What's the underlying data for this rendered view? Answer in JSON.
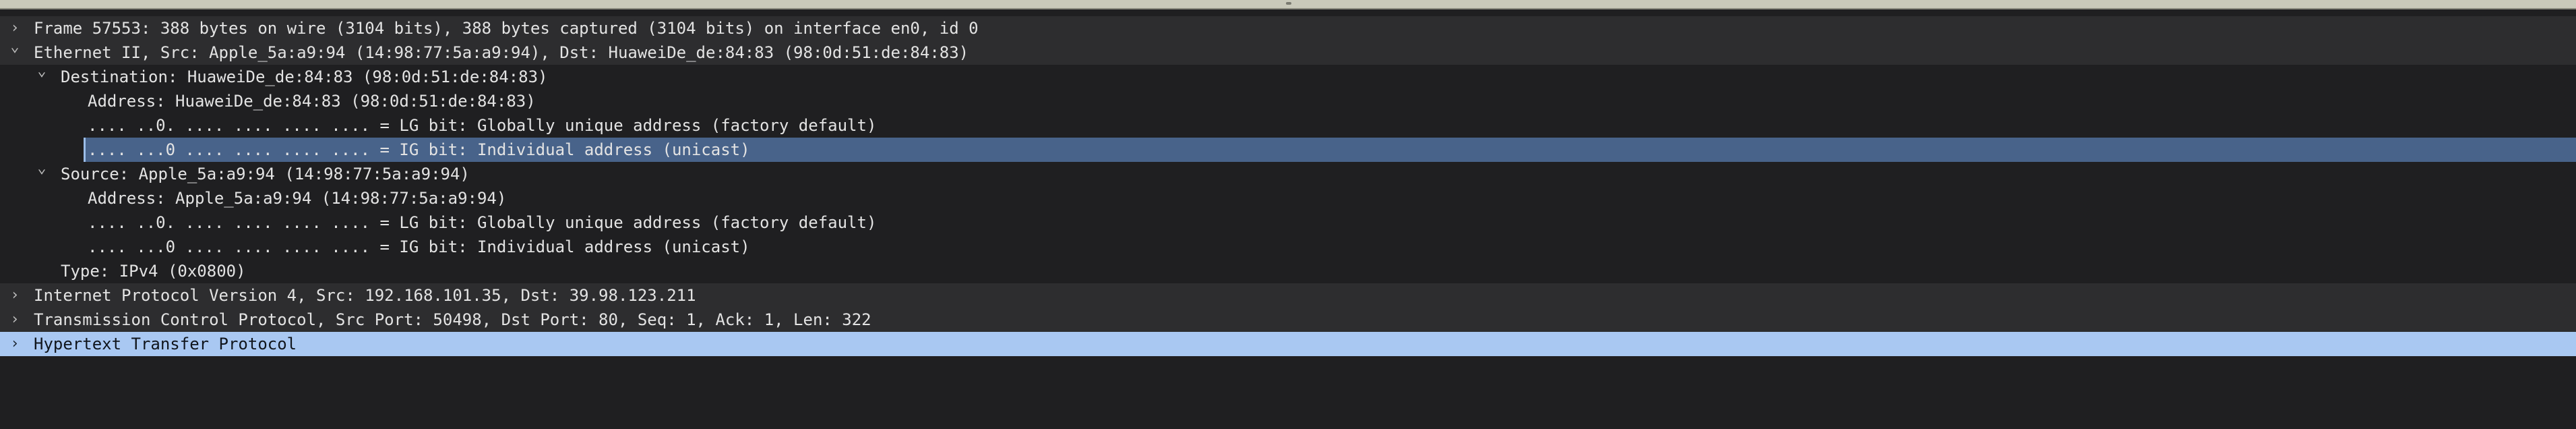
{
  "packet_details": {
    "rows": [
      {
        "text": "Frame 57553: 388 bytes on wire (3104 bits), 388 bytes captured (3104 bits) on interface en0, id 0"
      },
      {
        "text": "Ethernet II, Src: Apple_5a:a9:94 (14:98:77:5a:a9:94), Dst: HuaweiDe_de:84:83 (98:0d:51:de:84:83)"
      },
      {
        "text": "Destination: HuaweiDe_de:84:83 (98:0d:51:de:84:83)"
      },
      {
        "text": "Address: HuaweiDe_de:84:83 (98:0d:51:de:84:83)"
      },
      {
        "text": ".... ..0. .... .... .... .... = LG bit: Globally unique address (factory default)"
      },
      {
        "text": ".... ...0 .... .... .... .... = IG bit: Individual address (unicast)"
      },
      {
        "text": "Source: Apple_5a:a9:94 (14:98:77:5a:a9:94)"
      },
      {
        "text": "Address: Apple_5a:a9:94 (14:98:77:5a:a9:94)"
      },
      {
        "text": ".... ..0. .... .... .... .... = LG bit: Globally unique address (factory default)"
      },
      {
        "text": ".... ...0 .... .... .... .... = IG bit: Individual address (unicast)"
      },
      {
        "text": "Type: IPv4 (0x0800)"
      },
      {
        "text": "Internet Protocol Version 4, Src: 192.168.101.35, Dst: 39.98.123.211"
      },
      {
        "text": "Transmission Control Protocol, Src Port: 50498, Dst Port: 80, Seq: 1, Ack: 1, Len: 322"
      },
      {
        "text": "Hypertext Transfer Protocol"
      }
    ]
  }
}
